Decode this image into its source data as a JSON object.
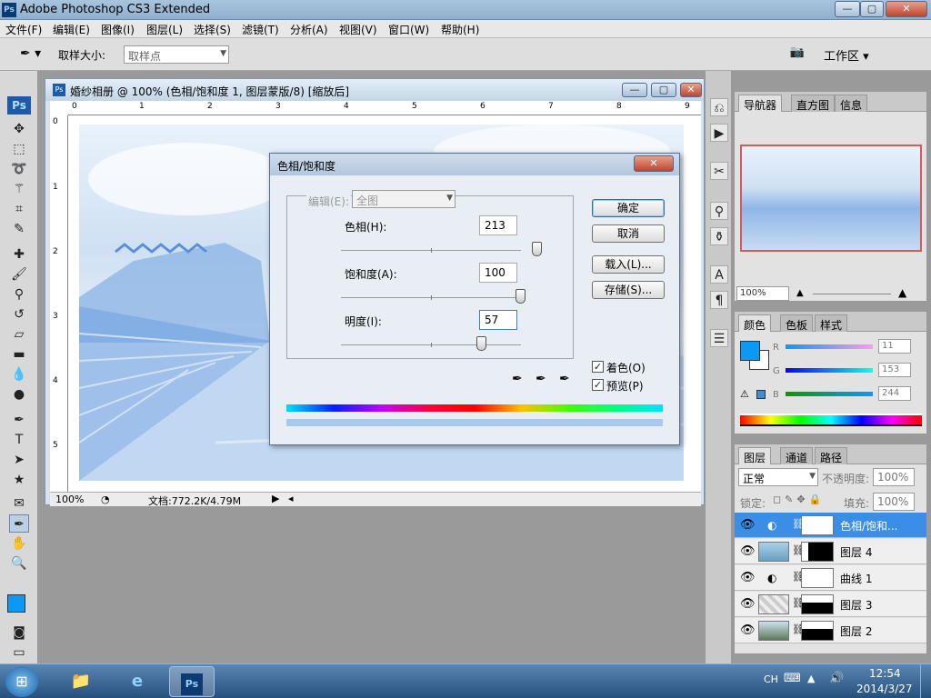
{
  "app_title": "Adobe Photoshop CS3 Extended",
  "app_badge": "Ps",
  "window_controls": {
    "minimize": "—",
    "restore": "▢",
    "close": "✕"
  },
  "menu": [
    "文件(F)",
    "编辑(E)",
    "图像(I)",
    "图层(L)",
    "选择(S)",
    "滤镜(T)",
    "分析(A)",
    "视图(V)",
    "窗口(W)",
    "帮助(H)"
  ],
  "options_bar": {
    "sample_size_label": "取样大小:",
    "sample_size_value": "取样点",
    "workspace_label": "工作区 ▾"
  },
  "document": {
    "title": "婚纱相册 @ 100% (色相/饱和度 1, 图层蒙版/8) [缩放后]",
    "ruler_top": [
      "0",
      "1",
      "2",
      "3",
      "4",
      "5",
      "6",
      "7",
      "8",
      "9"
    ],
    "ruler_left": [
      "0",
      "1",
      "2",
      "3",
      "4",
      "5"
    ],
    "zoom": "100%",
    "doc_info": "文档:772.2K/4.79M"
  },
  "dialog": {
    "title": "色相/饱和度",
    "edit_label": "编辑(E):",
    "edit_value": "全图",
    "hue_label": "色相(H):",
    "hue_value": "213",
    "hue_level": 213,
    "saturation_label": "饱和度(A):",
    "saturation_value": "100",
    "saturation_level": 100,
    "lightness_label": "明度(I):",
    "lightness_value": "57",
    "lightness_level": 57,
    "ok": "确定",
    "cancel": "取消",
    "load": "载入(L)...",
    "save": "存储(S)...",
    "colorize_label": "着色(O)",
    "colorize_checked": true,
    "preview_label": "预览(P)",
    "preview_checked": true,
    "colorize_color": "#a9c8ee"
  },
  "navigator_panel": {
    "tabs": [
      "导航器",
      "直方图",
      "信息"
    ],
    "zoom": "100%"
  },
  "color_panel": {
    "tabs": [
      "颜色",
      "色板",
      "样式"
    ],
    "r_label": "R",
    "r_value": "11",
    "g_label": "G",
    "g_value": "153",
    "b_label": "B",
    "b_value": "244",
    "foreground": "#0b99f4"
  },
  "layers_panel": {
    "tabs": [
      "图层",
      "通道",
      "路径"
    ],
    "blend_mode": "正常",
    "opacity_label": "不透明度:",
    "opacity_value": "100%",
    "lock_label": "锁定:",
    "fill_label": "填充:",
    "fill_value": "100%",
    "layers": [
      {
        "name": "色相/饱和...",
        "type": "adjustment",
        "selected": true
      },
      {
        "name": "图层 4",
        "type": "image",
        "selected": false
      },
      {
        "name": "曲线 1",
        "type": "adjustment",
        "selected": false
      },
      {
        "name": "图层 3",
        "type": "image",
        "selected": false
      },
      {
        "name": "图层 2",
        "type": "image",
        "selected": false
      }
    ]
  },
  "tray": {
    "lang": "CH",
    "time": "12:54",
    "date": "2014/3/27"
  }
}
